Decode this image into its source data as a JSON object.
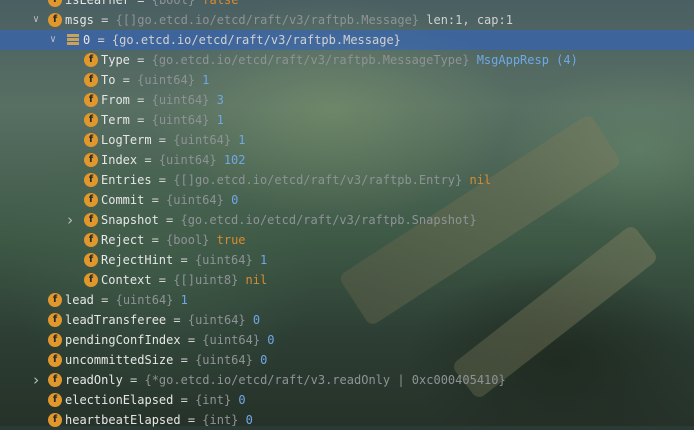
{
  "rows": [
    {
      "name": "isLearner",
      "type": "{bool}",
      "value": "false",
      "vclass": "val-kw",
      "indent": 0,
      "arrow": "none",
      "icon": "field"
    },
    {
      "name": "msgs",
      "type": "{[]go.etcd.io/etcd/raft/v3/raftpb.Message}",
      "value": "len:1, cap:1",
      "vclass": "val-str",
      "indent": 0,
      "arrow": "down",
      "icon": "field"
    },
    {
      "name": "0",
      "type": "",
      "value": "{go.etcd.io/etcd/raft/v3/raftpb.Message}",
      "vclass": "val-str",
      "indent": 1,
      "arrow": "down",
      "icon": "array",
      "selected": true
    },
    {
      "name": "Type",
      "type": "{go.etcd.io/etcd/raft/v3/raftpb.MessageType}",
      "value": "MsgAppResp (4)",
      "vclass": "val-num",
      "indent": 2,
      "arrow": "none",
      "icon": "field"
    },
    {
      "name": "To",
      "type": "{uint64}",
      "value": "1",
      "vclass": "val-num",
      "indent": 2,
      "arrow": "none",
      "icon": "field"
    },
    {
      "name": "From",
      "type": "{uint64}",
      "value": "3",
      "vclass": "val-num",
      "indent": 2,
      "arrow": "none",
      "icon": "field"
    },
    {
      "name": "Term",
      "type": "{uint64}",
      "value": "1",
      "vclass": "val-num",
      "indent": 2,
      "arrow": "none",
      "icon": "field"
    },
    {
      "name": "LogTerm",
      "type": "{uint64}",
      "value": "1",
      "vclass": "val-num",
      "indent": 2,
      "arrow": "none",
      "icon": "field"
    },
    {
      "name": "Index",
      "type": "{uint64}",
      "value": "102",
      "vclass": "val-num",
      "indent": 2,
      "arrow": "none",
      "icon": "field"
    },
    {
      "name": "Entries",
      "type": "{[]go.etcd.io/etcd/raft/v3/raftpb.Entry}",
      "value": "nil",
      "vclass": "val-kw",
      "indent": 2,
      "arrow": "none",
      "icon": "field"
    },
    {
      "name": "Commit",
      "type": "{uint64}",
      "value": "0",
      "vclass": "val-num",
      "indent": 2,
      "arrow": "none",
      "icon": "field"
    },
    {
      "name": "Snapshot",
      "type": "{go.etcd.io/etcd/raft/v3/raftpb.Snapshot}",
      "value": "",
      "vclass": "val-str",
      "indent": 2,
      "arrow": "right",
      "icon": "field"
    },
    {
      "name": "Reject",
      "type": "{bool}",
      "value": "true",
      "vclass": "val-kw",
      "indent": 2,
      "arrow": "none",
      "icon": "field"
    },
    {
      "name": "RejectHint",
      "type": "{uint64}",
      "value": "1",
      "vclass": "val-num",
      "indent": 2,
      "arrow": "none",
      "icon": "field"
    },
    {
      "name": "Context",
      "type": "{[]uint8}",
      "value": "nil",
      "vclass": "val-kw",
      "indent": 2,
      "arrow": "none",
      "icon": "field"
    },
    {
      "name": "lead",
      "type": "{uint64}",
      "value": "1",
      "vclass": "val-num",
      "indent": 0,
      "arrow": "none",
      "icon": "field"
    },
    {
      "name": "leadTransferee",
      "type": "{uint64}",
      "value": "0",
      "vclass": "val-num",
      "indent": 0,
      "arrow": "none",
      "icon": "field"
    },
    {
      "name": "pendingConfIndex",
      "type": "{uint64}",
      "value": "0",
      "vclass": "val-num",
      "indent": 0,
      "arrow": "none",
      "icon": "field"
    },
    {
      "name": "uncommittedSize",
      "type": "{uint64}",
      "value": "0",
      "vclass": "val-num",
      "indent": 0,
      "arrow": "none",
      "icon": "field"
    },
    {
      "name": "readOnly",
      "type": "{*go.etcd.io/etcd/raft/v3.readOnly | 0xc000405410}",
      "value": "",
      "vclass": "val-str",
      "indent": 0,
      "arrow": "right",
      "icon": "field"
    },
    {
      "name": "electionElapsed",
      "type": "{int}",
      "value": "0",
      "vclass": "val-num",
      "indent": 0,
      "arrow": "none",
      "icon": "field"
    },
    {
      "name": "heartbeatElapsed",
      "type": "{int}",
      "value": "0",
      "vclass": "val-num",
      "indent": 0,
      "arrow": "none",
      "icon": "field"
    }
  ],
  "icons": {
    "field": "f",
    "field_color": "#e0972c",
    "array_color": "#c9a35a",
    "selection_color": "#2f65ca"
  }
}
